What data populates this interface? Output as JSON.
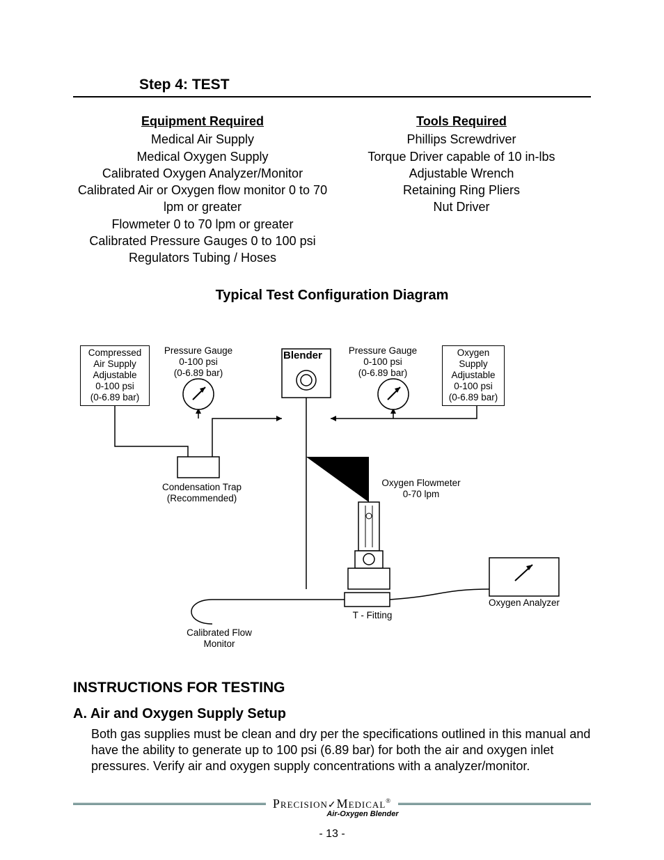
{
  "step_header": "Step 4: TEST",
  "equipment": {
    "heading": "Equipment Required",
    "items": [
      "Medical Air Supply",
      "Medical Oxygen Supply",
      "Calibrated Oxygen Analyzer/Monitor",
      "Calibrated Air or Oxygen flow monitor 0 to 70 lpm or greater",
      "Flowmeter 0 to 70 lpm or greater",
      "Calibrated Pressure Gauges 0 to 100 psi",
      "Regulators Tubing / Hoses"
    ]
  },
  "tools": {
    "heading": "Tools Required",
    "items": [
      "Phillips Screwdriver",
      "Torque Driver capable of 10 in-lbs",
      "Adjustable Wrench",
      "Retaining Ring Pliers",
      "Nut Driver"
    ]
  },
  "diagram": {
    "title": "Typical Test Configuration Diagram",
    "air_supply": "Compressed\nAir Supply\nAdjustable\n0-100 psi\n(0-6.89 bar)",
    "gauge_left": "Pressure Gauge\n0-100 psi\n(0-6.89 bar)",
    "blender": "Blender",
    "gauge_right": "Pressure Gauge\n0-100 psi\n(0-6.89 bar)",
    "oxygen_supply": "Oxygen\nSupply\nAdjustable\n0-100 psi\n(0-6.89 bar)",
    "cond_trap": "Condensation Trap\n(Recommended)",
    "oxygen_flowmeter": "Oxygen Flowmeter\n0-70 lpm",
    "analyzer": "Oxygen Analyzer",
    "t_fitting": "T - Fitting",
    "flow_monitor": "Calibrated Flow\nMonitor"
  },
  "instructions": {
    "heading": "INSTRUCTIONS FOR TESTING",
    "section_a": {
      "heading": "A. Air and Oxygen Supply Setup",
      "body": "Both gas supplies must be clean and dry per the specifications outlined in this manual and have the ability to generate up to 100 psi (6.89 bar) for both the air and oxygen inlet pressures. Verify air and oxygen supply concentrations with a analyzer/monitor."
    }
  },
  "footer": {
    "brand_1": "Precision",
    "brand_2": "Medical",
    "subtitle": "Air-Oxygen Blender"
  },
  "page_number": "- 13 -"
}
